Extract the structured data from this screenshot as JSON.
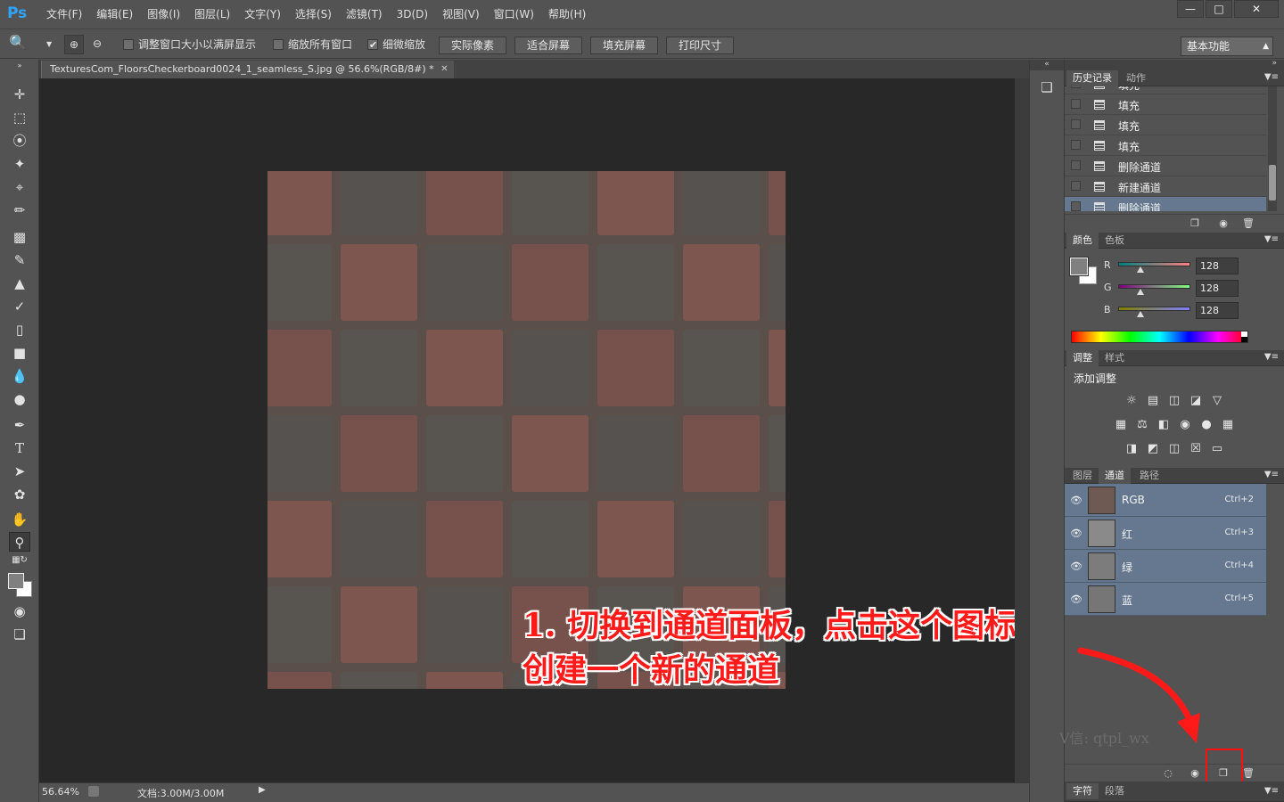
{
  "app": {
    "logo": "Ps",
    "menu": [
      "文件(F)",
      "编辑(E)",
      "图像(I)",
      "图层(L)",
      "文字(Y)",
      "选择(S)",
      "滤镜(T)",
      "3D(D)",
      "视图(V)",
      "窗口(W)",
      "帮助(H)"
    ],
    "window_controls": [
      "minimize-icon",
      "maximize-icon",
      "close-icon"
    ]
  },
  "options_bar": {
    "resize_windows_label": "调整窗口大小以满屏显示",
    "resize_windows_checked": false,
    "zoom_all_label": "缩放所有窗口",
    "zoom_all_checked": false,
    "scrubby_zoom_label": "细微缩放",
    "scrubby_zoom_checked": true,
    "actual_pixels": "实际像素",
    "fit_screen": "适合屏幕",
    "fill_screen": "填充屏幕",
    "print_size": "打印尺寸",
    "workspace": "基本功能"
  },
  "document": {
    "tab_title": "TexturesCom_FloorsCheckerboard0024_1_seamless_S.jpg @ 56.6%(RGB/8#) *",
    "zoom": "56.64%",
    "doc_size": "文档:3.00M/3.00M"
  },
  "history_panel": {
    "tabs": [
      "历史记录",
      "动作"
    ],
    "rows": [
      "填充",
      "填充",
      "填充",
      "填充",
      "删除通道",
      "新建通道",
      "删除通道"
    ]
  },
  "color_panel": {
    "tabs": [
      "颜色",
      "色板"
    ],
    "channels": [
      {
        "label": "R",
        "value": "128"
      },
      {
        "label": "G",
        "value": "128"
      },
      {
        "label": "B",
        "value": "128"
      }
    ],
    "foreground": "#808080",
    "background": "#ffffff"
  },
  "adjustments_panel": {
    "tabs": [
      "调整",
      "样式"
    ],
    "title": "添加调整"
  },
  "channels_panel": {
    "tabs": [
      "图层",
      "通道",
      "路径"
    ],
    "rows": [
      {
        "name": "RGB",
        "shortcut": "Ctrl+2"
      },
      {
        "name": "红",
        "shortcut": "Ctrl+3"
      },
      {
        "name": "绿",
        "shortcut": "Ctrl+4"
      },
      {
        "name": "蓝",
        "shortcut": "Ctrl+5"
      }
    ]
  },
  "bottom_panel": {
    "tabs": [
      "字符",
      "段落"
    ]
  },
  "annotation": {
    "line1": "1. 切换到通道面板，点击这个图标",
    "line2": "创建一个新的通道",
    "color": "#ff1a1a"
  },
  "watermark": "V信: qtpl_wx"
}
